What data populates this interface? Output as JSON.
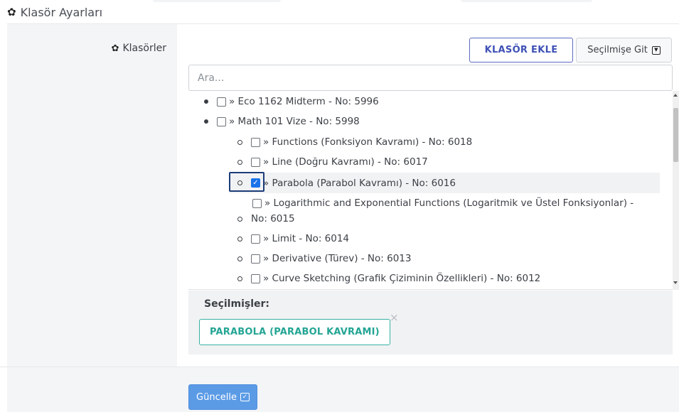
{
  "section": {
    "title": "Klasör Ayarları",
    "icon": "gear-icon"
  },
  "field": {
    "label": "Klasörler",
    "icon": "gear-icon"
  },
  "toolbar": {
    "add_label": "KLASÖR EKLE",
    "go_label": "Seçilmişe Git",
    "go_icon": "caret-square-down-icon"
  },
  "search": {
    "placeholder": "Ara...",
    "value": ""
  },
  "tree": {
    "items": [
      {
        "label": "» Eco 1162 Midterm - No: 5996",
        "level": 0,
        "checked": false
      },
      {
        "label": "» Math 101 Vize - No: 5998",
        "level": 0,
        "checked": false
      },
      {
        "label": "» Functions (Fonksiyon Kavramı) - No: 6018",
        "level": 1,
        "checked": false
      },
      {
        "label": "» Line (Doğru Kavramı) - No: 6017",
        "level": 1,
        "checked": false
      },
      {
        "label": "» Parabola (Parabol Kavramı) - No: 6016",
        "level": 1,
        "checked": true
      },
      {
        "label": "» Logarithmic and Exponential Functions (Logaritmik ve Üstel Fonksiyonlar) -",
        "label_cont": "No: 6015",
        "level": 1,
        "checked": false
      },
      {
        "label": "» Limit - No: 6014",
        "level": 1,
        "checked": false
      },
      {
        "label": "» Derivative (Türev) - No: 6013",
        "level": 1,
        "checked": false
      },
      {
        "label": "» Curve Sketching (Grafik Çiziminin Özellikleri) - No: 6012",
        "level": 1,
        "checked": false
      }
    ]
  },
  "selected": {
    "title": "Seçilmişler:",
    "tags": [
      "PARABOLA (PARABOL KAVRAMI)"
    ],
    "remove_glyph": "×"
  },
  "footer": {
    "update_label": "Güncelle",
    "update_icon": "check-square-icon"
  },
  "colors": {
    "accent_blue": "#3f51b5",
    "tag_teal": "#23a594",
    "update_bg": "#5b9be6",
    "checkbox_blue": "#1a73e8",
    "focus_ring": "#1c3d78"
  }
}
